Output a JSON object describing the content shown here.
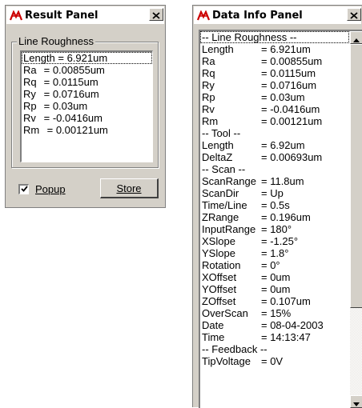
{
  "result_panel": {
    "title": "Result Panel",
    "close_label": "✕",
    "group_label": "Line Roughness",
    "items": [
      {
        "label": "Length",
        "value": "= 6.921um"
      },
      {
        "label": "Ra",
        "value": "= 0.00855um"
      },
      {
        "label": "Rq",
        "value": "= 0.0115um"
      },
      {
        "label": "Ry",
        "value": "= 0.0716um"
      },
      {
        "label": "Rp",
        "value": "= 0.03um"
      },
      {
        "label": "Rv",
        "value": "= -0.0416um"
      },
      {
        "label": "Rm",
        "value": "= 0.00121um"
      }
    ],
    "popup_label": "Popup",
    "popup_checked": true,
    "store_label": "Store"
  },
  "data_info_panel": {
    "title": "Data Info Panel",
    "close_label": "✕",
    "rows": [
      {
        "label": "-- Line Roughness --",
        "value": ""
      },
      {
        "label": "Length",
        "value": "= 6.921um"
      },
      {
        "label": "Ra",
        "value": "= 0.00855um"
      },
      {
        "label": "Rq",
        "value": "= 0.0115um"
      },
      {
        "label": "Ry",
        "value": "= 0.0716um"
      },
      {
        "label": "Rp",
        "value": "= 0.03um"
      },
      {
        "label": "Rv",
        "value": "= -0.0416um"
      },
      {
        "label": "Rm",
        "value": "= 0.00121um"
      },
      {
        "label": "-- Tool --",
        "value": ""
      },
      {
        "label": "Length",
        "value": "= 6.92um"
      },
      {
        "label": "DeltaZ",
        "value": "= 0.00693um"
      },
      {
        "label": "-- Scan --",
        "value": ""
      },
      {
        "label": "ScanRange",
        "value": "= 11.8um"
      },
      {
        "label": "ScanDir",
        "value": "= Up"
      },
      {
        "label": "Time/Line",
        "value": "= 0.5s"
      },
      {
        "label": "ZRange",
        "value": "= 0.196um"
      },
      {
        "label": "InputRange",
        "value": "= 180°"
      },
      {
        "label": "XSlope",
        "value": "= -1.25°"
      },
      {
        "label": "YSlope",
        "value": "= 1.8°"
      },
      {
        "label": "Rotation",
        "value": "= 0°"
      },
      {
        "label": "XOffset",
        "value": "= 0um"
      },
      {
        "label": "YOffset",
        "value": "= 0um"
      },
      {
        "label": "ZOffset",
        "value": "= 0.107um"
      },
      {
        "label": "OverScan",
        "value": "= 15%"
      },
      {
        "label": "Date",
        "value": "= 08-04-2003"
      },
      {
        "label": "Time",
        "value": "= 14:13:47"
      },
      {
        "label": "-- Feedback --",
        "value": ""
      },
      {
        "label": "TipVoltage",
        "value": "= 0V"
      }
    ]
  },
  "icons": {
    "app_icon": "app-logo-icon",
    "close": "close-icon",
    "scroll_up": "arrow-up-icon",
    "scroll_down": "arrow-down-icon",
    "check": "checkmark-icon"
  },
  "colors": {
    "window_bg": "#d4d0c8",
    "title_bg": "#ffffff",
    "app_icon_red": "#cc0000"
  }
}
